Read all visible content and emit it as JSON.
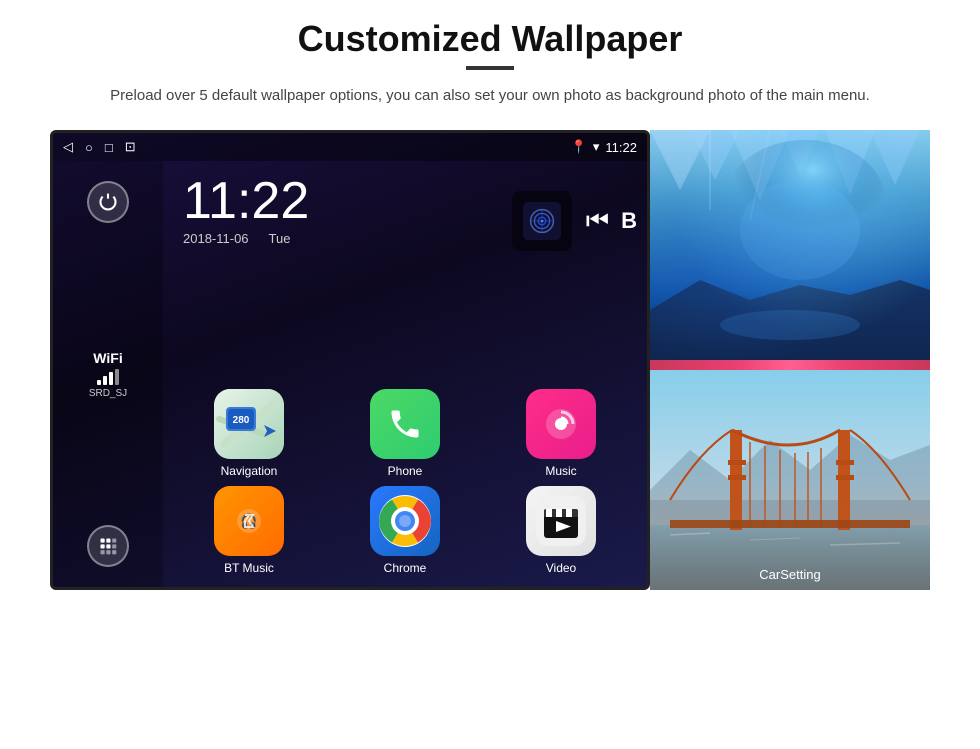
{
  "header": {
    "title": "Customized Wallpaper",
    "description": "Preload over 5 default wallpaper options, you can also set your own photo as background photo of the main menu."
  },
  "android": {
    "status_bar": {
      "time": "11:22",
      "icons": [
        "back",
        "home",
        "recent",
        "screenshot"
      ]
    },
    "clock": {
      "time": "11:22",
      "date": "2018-11-06",
      "day": "Tue"
    },
    "wifi": {
      "label": "WiFi",
      "ssid": "SRD_SJ"
    },
    "apps": [
      {
        "id": "navigation",
        "label": "Navigation",
        "icon_type": "nav"
      },
      {
        "id": "phone",
        "label": "Phone",
        "icon_type": "phone"
      },
      {
        "id": "music",
        "label": "Music",
        "icon_type": "music"
      },
      {
        "id": "bt_music",
        "label": "BT Music",
        "icon_type": "bt"
      },
      {
        "id": "chrome",
        "label": "Chrome",
        "icon_type": "chrome"
      },
      {
        "id": "video",
        "label": "Video",
        "icon_type": "video"
      }
    ],
    "wallpapers": [
      {
        "id": "ice_cave",
        "type": "ice"
      },
      {
        "id": "bridge",
        "type": "bridge",
        "label": "CarSetting"
      }
    ]
  }
}
